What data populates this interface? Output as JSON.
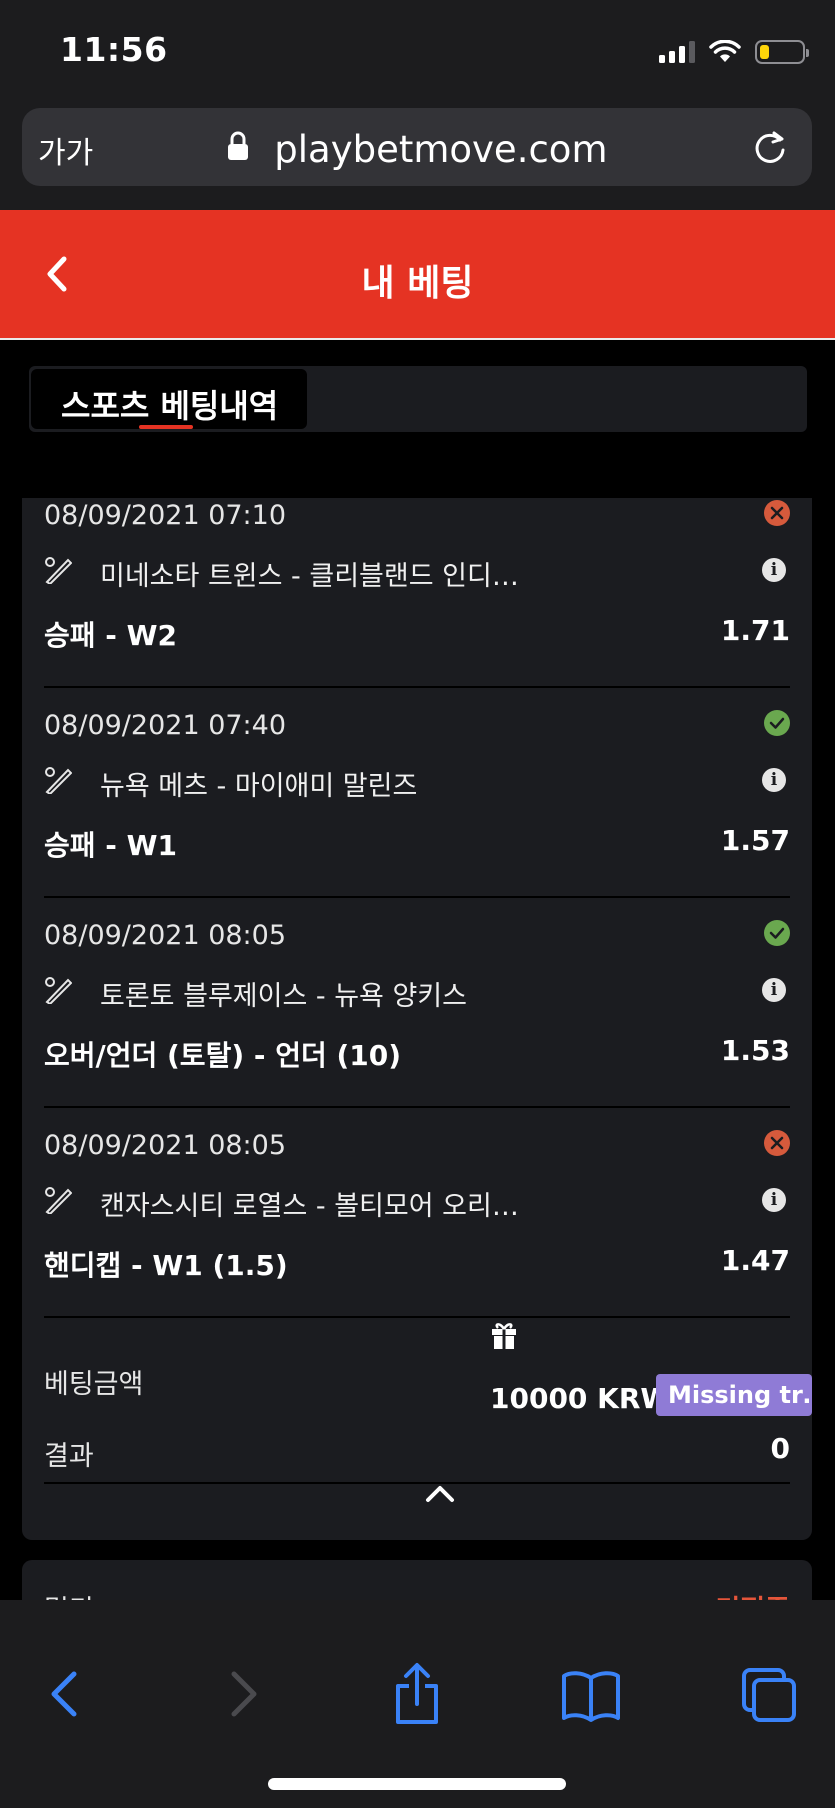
{
  "status_bar": {
    "time": "11:56"
  },
  "browser": {
    "text_size_label": "가가",
    "url": "playbetmove.com"
  },
  "header": {
    "title": "내 베팅"
  },
  "tabs": [
    {
      "label": "스포츠 베팅내역",
      "active": true
    }
  ],
  "bets": [
    {
      "date": "08/09/2021 07:10",
      "status": "lost",
      "match": "미네소타 트윈스 - 클리블랜드 인디…",
      "market": "승패 - W2",
      "odds": "1.71"
    },
    {
      "date": "08/09/2021 07:40",
      "status": "won",
      "match": "뉴욕 메츠 - 마이애미 말린즈",
      "market": "승패 - W1",
      "odds": "1.57"
    },
    {
      "date": "08/09/2021 08:05",
      "status": "won",
      "match": "토론토 블루제이스 - 뉴욕 양키스",
      "market": "오버/언더 (토탈) - 언더 (10)",
      "odds": "1.53"
    },
    {
      "date": "08/09/2021 08:05",
      "status": "lost",
      "match": "캔자스시티 로열스 - 볼티모어 오리…",
      "market": "핸디캡 - W1 (1.5)",
      "odds": "1.47"
    }
  ],
  "summary": {
    "stake_label": "베팅금액",
    "stake_amount": "10000 KRW",
    "badge": "Missing tr…",
    "result_label": "결과",
    "result_value": "0"
  },
  "next_card": {
    "left_text": "멀티",
    "right_text": "미적중"
  },
  "colors": {
    "header_red": "#e53323",
    "won_green": "#6aa84f",
    "lost_red": "#d65a3c",
    "badge_purple": "#8f7bd6",
    "ios_blue": "#3a82f7"
  }
}
